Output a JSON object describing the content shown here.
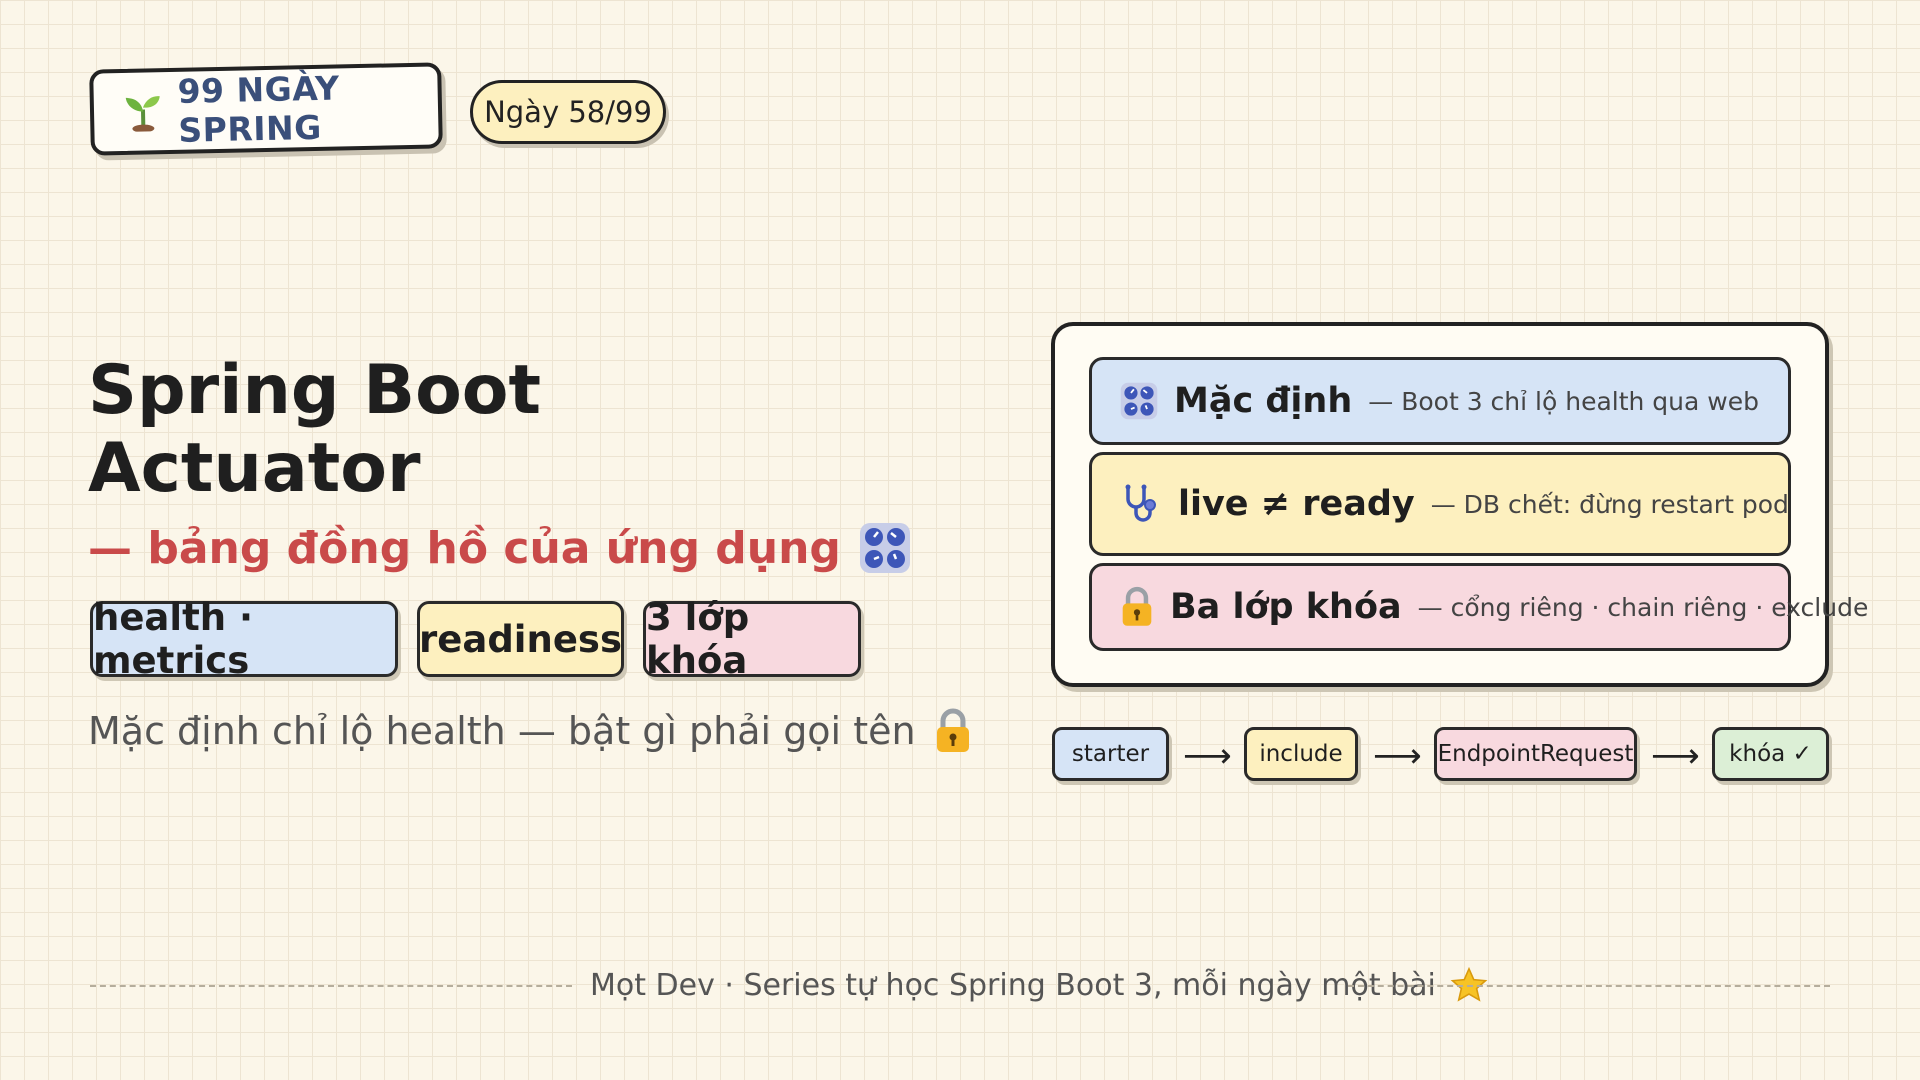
{
  "header": {
    "brand_icon": "sprout-icon",
    "brand_text": "99 NGÀY SPRING",
    "day_label": "Ngày 58/99"
  },
  "title": {
    "line1": "Spring Boot",
    "line2": "Actuator",
    "subtitle": "— bảng đồng hồ của ứng dụng",
    "subtitle_icon": "gauges-icon"
  },
  "tags": [
    "health · metrics",
    "readiness",
    "3 lớp khóa"
  ],
  "note": {
    "text": "Mặc định chỉ lộ health — bật gì phải gọi tên",
    "icon": "lock-icon"
  },
  "panel": {
    "rows": [
      {
        "icon": "gauges-icon",
        "title": "Mặc định",
        "desc": "— Boot 3 chỉ lộ health qua web"
      },
      {
        "icon": "stethoscope-icon",
        "title": "live ≠ ready",
        "desc": "— DB chết: đừng restart pod"
      },
      {
        "icon": "lock-icon",
        "title": "Ba lớp khóa",
        "desc": "— cổng riêng · chain riêng · exclude"
      }
    ]
  },
  "flow": {
    "steps": [
      "starter",
      "include",
      "EndpointRequest",
      "khóa ✓"
    ],
    "arrow": "⟶"
  },
  "footer": {
    "text": "Mọt Dev · Series tự học Spring Boot 3, mỗi ngày một bài",
    "icon": "star-icon"
  },
  "colors": {
    "background": "#fbf6e9",
    "blue": "#d6e4f6",
    "yellow": "#fdf0bf",
    "pink": "#f8d9df",
    "green": "#dcefd6",
    "accent_red": "#c94a4a"
  }
}
